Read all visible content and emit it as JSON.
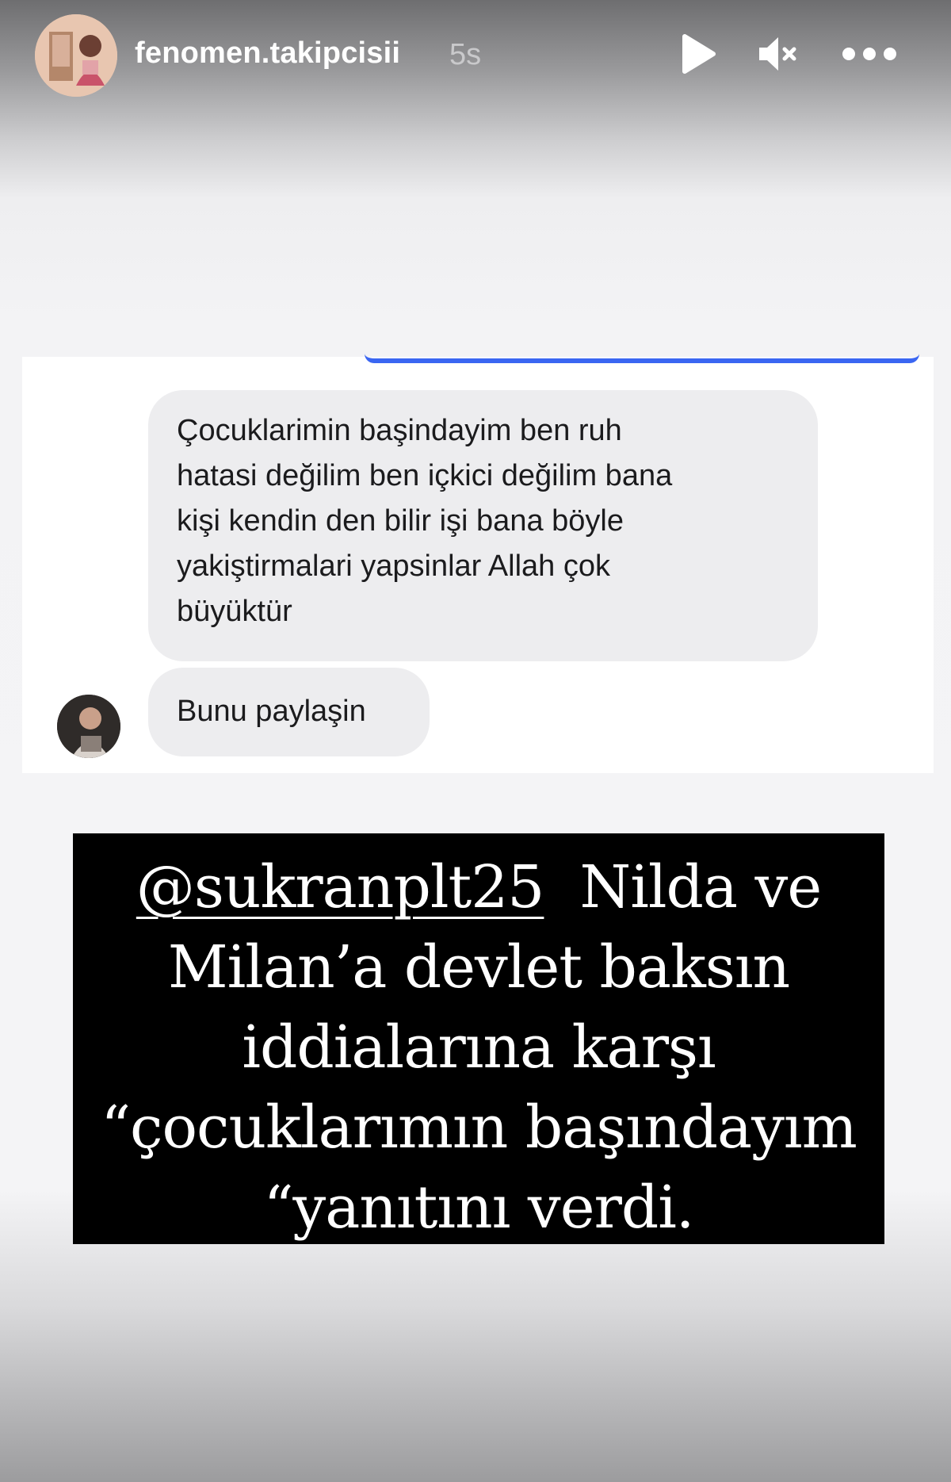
{
  "header": {
    "username": "fenomen.takipcisii",
    "timestamp": "5s",
    "icons": [
      "play-icon",
      "mute-icon",
      "more-icon"
    ]
  },
  "chat": {
    "message_1_lines": [
      "Çocuklarimin başindayim ben ruh",
      "hatasi değilim ben içkici değilim bana",
      "kişi kendin den bilir işi bana böyle",
      "yakiştirmalari yapsinlar Allah çok",
      "büyüktür"
    ],
    "message_2": "Bunu paylaşin",
    "accent_color": "#3a66f2"
  },
  "caption": {
    "mention": "@sukranplt25",
    "line_1_rest": "Nilda ve",
    "line_2": "Milan’a devlet baksın",
    "line_3": "iddialarına karşı",
    "line_4": "“çocuklarımın başındayım",
    "line_5": "“yanıtını verdi."
  }
}
